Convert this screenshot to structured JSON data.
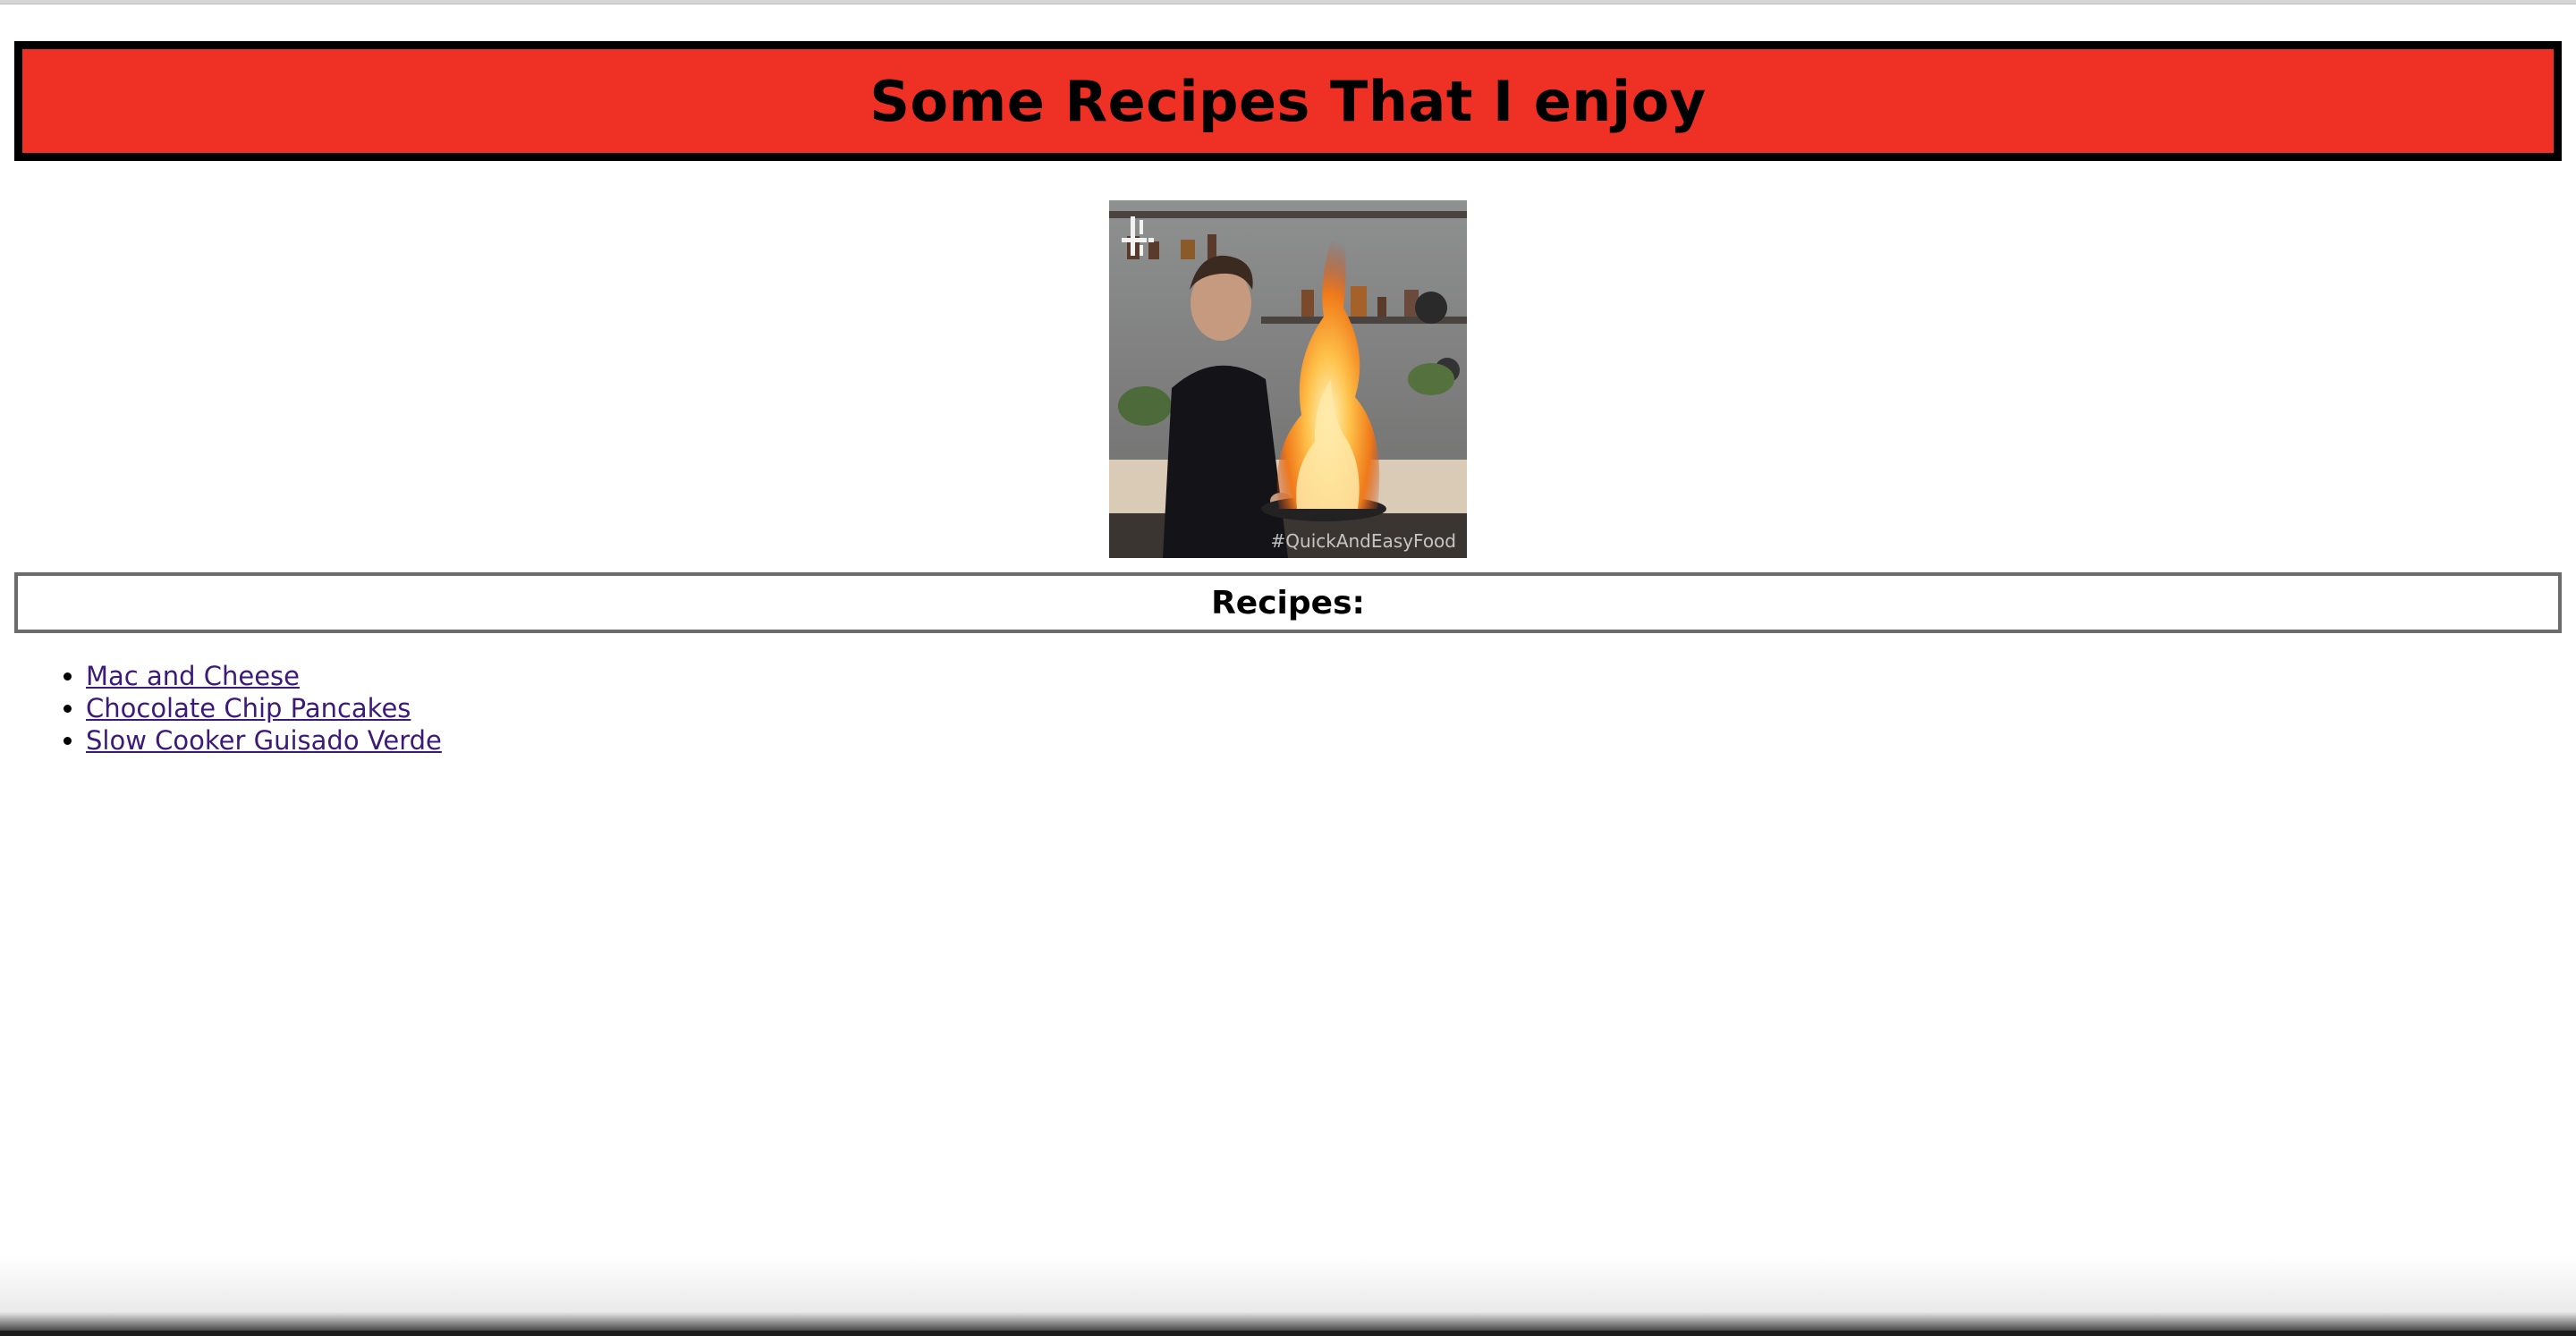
{
  "page": {
    "title": "Some Recipes That I enjoy",
    "section_heading": "Recipes:"
  },
  "hero_image": {
    "watermark": "#QuickAndEasyFood",
    "logo_mark": "4"
  },
  "recipes": [
    {
      "label": "Mac and Cheese"
    },
    {
      "label": "Chocolate Chip Pancakes"
    },
    {
      "label": "Slow Cooker Guisado Verde"
    }
  ],
  "colors": {
    "banner_background": "#ee3124",
    "banner_border": "#000000",
    "link_visited": "#3b1a7a"
  }
}
